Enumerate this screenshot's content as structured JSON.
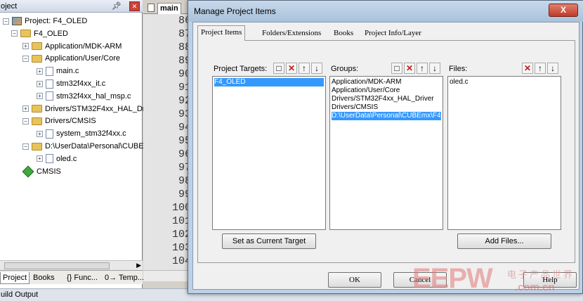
{
  "project_panel": {
    "header": "oject",
    "tree": [
      {
        "label": "Project: F4_OLED",
        "level": 0,
        "type": "project",
        "expanded": true
      },
      {
        "label": "F4_OLED",
        "level": 1,
        "type": "target",
        "expanded": true
      },
      {
        "label": "Application/MDK-ARM",
        "level": 2,
        "type": "folder",
        "expanded": false
      },
      {
        "label": "Application/User/Core",
        "level": 2,
        "type": "folder",
        "expanded": true
      },
      {
        "label": "main.c",
        "level": 3,
        "type": "file"
      },
      {
        "label": "stm32f4xx_it.c",
        "level": 3,
        "type": "file"
      },
      {
        "label": "stm32f4xx_hal_msp.c",
        "level": 3,
        "type": "file"
      },
      {
        "label": "Drivers/STM32F4xx_HAL_Driv",
        "level": 2,
        "type": "folder",
        "expanded": false
      },
      {
        "label": "Drivers/CMSIS",
        "level": 2,
        "type": "folder",
        "expanded": true
      },
      {
        "label": "system_stm32f4xx.c",
        "level": 3,
        "type": "file"
      },
      {
        "label": "D:\\UserData\\Personal\\CUBEn",
        "level": 2,
        "type": "folder",
        "expanded": true
      },
      {
        "label": "oled.c",
        "level": 3,
        "type": "file"
      },
      {
        "label": "CMSIS",
        "level": 2,
        "type": "gem"
      }
    ],
    "bottom_tabs": [
      "Project",
      "Books",
      "{} Func...",
      "0→ Temp..."
    ]
  },
  "build_output_label": "uild Output",
  "editor": {
    "tab_label": "main",
    "line_numbers": [
      "86",
      "87",
      "88",
      "89",
      "90",
      "91",
      "92",
      "93",
      "94",
      "95",
      "96",
      "97",
      "98",
      "99",
      "100",
      "101",
      "102",
      "103",
      "104"
    ]
  },
  "dialog": {
    "title": "Manage Project Items",
    "close_glyph": "X",
    "tabs": [
      "Project Items",
      "Folders/Extensions",
      "Books",
      "Project Info/Layer"
    ],
    "targets": {
      "label": "Project Targets:",
      "items": [
        "F4_OLED"
      ],
      "selected": 0
    },
    "groups": {
      "label": "Groups:",
      "items": [
        "Application/MDK-ARM",
        "Application/User/Core",
        "Drivers/STM32F4xx_HAL_Driver",
        "Drivers/CMSIS",
        "D:\\UserData\\Personal\\CUBEmx\\F4_("
      ],
      "selected": 4
    },
    "files": {
      "label": "Files:",
      "items": [
        "oled.c"
      ]
    },
    "set_current_target": "Set as Current Target",
    "add_files": "Add Files...",
    "ok": "OK",
    "cancel": "Cancel",
    "help": "Help"
  },
  "watermark": {
    "logo": "EEPW",
    "sub": "电子产品世界",
    "com": ".com.cn"
  }
}
